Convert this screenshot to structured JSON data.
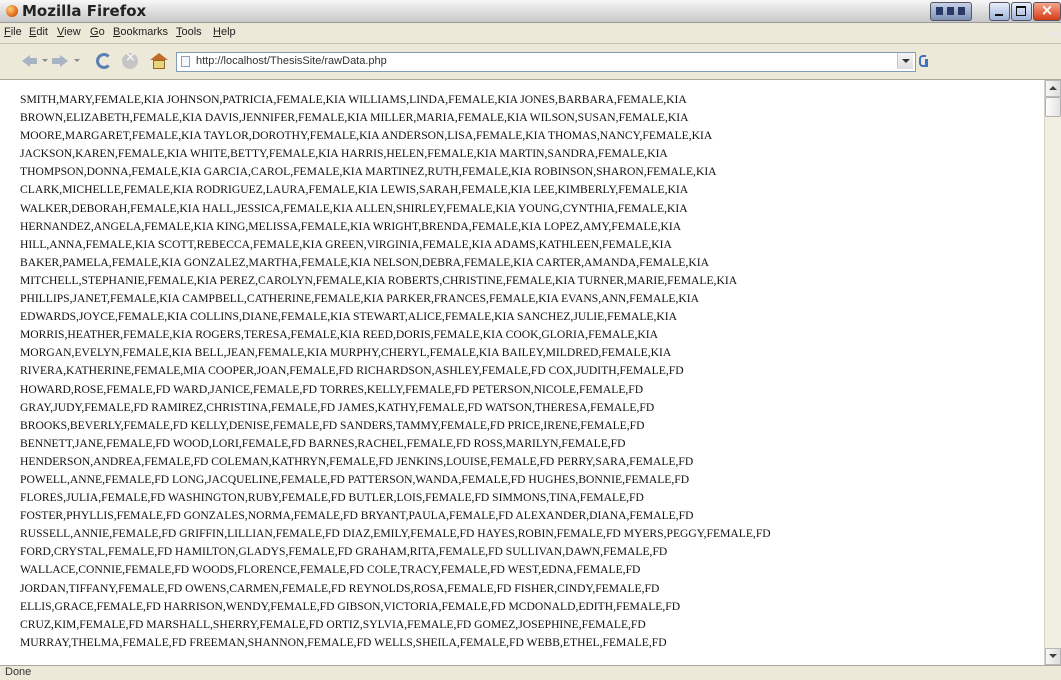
{
  "window": {
    "title": "Mozilla Firefox"
  },
  "menu": {
    "file": "File",
    "edit": "Edit",
    "view": "View",
    "go": "Go",
    "bookmarks": "Bookmarks",
    "tools": "Tools",
    "help": "Help"
  },
  "navigation": {
    "url": "http://localhost/ThesisSite/rawData.php"
  },
  "page": {
    "lines": [
      "SMITH,MARY,FEMALE,KIA JOHNSON,PATRICIA,FEMALE,KIA WILLIAMS,LINDA,FEMALE,KIA JONES,BARBARA,FEMALE,KIA",
      "BROWN,ELIZABETH,FEMALE,KIA DAVIS,JENNIFER,FEMALE,KIA MILLER,MARIA,FEMALE,KIA WILSON,SUSAN,FEMALE,KIA",
      "MOORE,MARGARET,FEMALE,KIA TAYLOR,DOROTHY,FEMALE,KIA ANDERSON,LISA,FEMALE,KIA THOMAS,NANCY,FEMALE,KIA",
      "JACKSON,KAREN,FEMALE,KIA WHITE,BETTY,FEMALE,KIA HARRIS,HELEN,FEMALE,KIA MARTIN,SANDRA,FEMALE,KIA",
      "THOMPSON,DONNA,FEMALE,KIA GARCIA,CAROL,FEMALE,KIA MARTINEZ,RUTH,FEMALE,KIA ROBINSON,SHARON,FEMALE,KIA",
      "CLARK,MICHELLE,FEMALE,KIA RODRIGUEZ,LAURA,FEMALE,KIA LEWIS,SARAH,FEMALE,KIA LEE,KIMBERLY,FEMALE,KIA",
      "WALKER,DEBORAH,FEMALE,KIA HALL,JESSICA,FEMALE,KIA ALLEN,SHIRLEY,FEMALE,KIA YOUNG,CYNTHIA,FEMALE,KIA",
      "HERNANDEZ,ANGELA,FEMALE,KIA KING,MELISSA,FEMALE,KIA WRIGHT,BRENDA,FEMALE,KIA LOPEZ,AMY,FEMALE,KIA",
      "HILL,ANNA,FEMALE,KIA SCOTT,REBECCA,FEMALE,KIA GREEN,VIRGINIA,FEMALE,KIA ADAMS,KATHLEEN,FEMALE,KIA",
      "BAKER,PAMELA,FEMALE,KIA GONZALEZ,MARTHA,FEMALE,KIA NELSON,DEBRA,FEMALE,KIA CARTER,AMANDA,FEMALE,KIA",
      "MITCHELL,STEPHANIE,FEMALE,KIA PEREZ,CAROLYN,FEMALE,KIA ROBERTS,CHRISTINE,FEMALE,KIA TURNER,MARIE,FEMALE,KIA",
      "PHILLIPS,JANET,FEMALE,KIA CAMPBELL,CATHERINE,FEMALE,KIA PARKER,FRANCES,FEMALE,KIA EVANS,ANN,FEMALE,KIA",
      "EDWARDS,JOYCE,FEMALE,KIA COLLINS,DIANE,FEMALE,KIA STEWART,ALICE,FEMALE,KIA SANCHEZ,JULIE,FEMALE,KIA",
      "MORRIS,HEATHER,FEMALE,KIA ROGERS,TERESA,FEMALE,KIA REED,DORIS,FEMALE,KIA COOK,GLORIA,FEMALE,KIA",
      "MORGAN,EVELYN,FEMALE,KIA BELL,JEAN,FEMALE,KIA MURPHY,CHERYL,FEMALE,KIA BAILEY,MILDRED,FEMALE,KIA",
      "RIVERA,KATHERINE,FEMALE,MIA COOPER,JOAN,FEMALE,FD RICHARDSON,ASHLEY,FEMALE,FD COX,JUDITH,FEMALE,FD",
      "HOWARD,ROSE,FEMALE,FD WARD,JANICE,FEMALE,FD TORRES,KELLY,FEMALE,FD PETERSON,NICOLE,FEMALE,FD",
      "GRAY,JUDY,FEMALE,FD RAMIREZ,CHRISTINA,FEMALE,FD JAMES,KATHY,FEMALE,FD WATSON,THERESA,FEMALE,FD",
      "BROOKS,BEVERLY,FEMALE,FD KELLY,DENISE,FEMALE,FD SANDERS,TAMMY,FEMALE,FD PRICE,IRENE,FEMALE,FD",
      "BENNETT,JANE,FEMALE,FD WOOD,LORI,FEMALE,FD BARNES,RACHEL,FEMALE,FD ROSS,MARILYN,FEMALE,FD",
      "HENDERSON,ANDREA,FEMALE,FD COLEMAN,KATHRYN,FEMALE,FD JENKINS,LOUISE,FEMALE,FD PERRY,SARA,FEMALE,FD",
      "POWELL,ANNE,FEMALE,FD LONG,JACQUELINE,FEMALE,FD PATTERSON,WANDA,FEMALE,FD HUGHES,BONNIE,FEMALE,FD",
      "FLORES,JULIA,FEMALE,FD WASHINGTON,RUBY,FEMALE,FD BUTLER,LOIS,FEMALE,FD SIMMONS,TINA,FEMALE,FD",
      "FOSTER,PHYLLIS,FEMALE,FD GONZALES,NORMA,FEMALE,FD BRYANT,PAULA,FEMALE,FD ALEXANDER,DIANA,FEMALE,FD",
      "RUSSELL,ANNIE,FEMALE,FD GRIFFIN,LILLIAN,FEMALE,FD DIAZ,EMILY,FEMALE,FD HAYES,ROBIN,FEMALE,FD MYERS,PEGGY,FEMALE,FD",
      "FORD,CRYSTAL,FEMALE,FD HAMILTON,GLADYS,FEMALE,FD GRAHAM,RITA,FEMALE,FD SULLIVAN,DAWN,FEMALE,FD",
      "WALLACE,CONNIE,FEMALE,FD WOODS,FLORENCE,FEMALE,FD COLE,TRACY,FEMALE,FD WEST,EDNA,FEMALE,FD",
      "JORDAN,TIFFANY,FEMALE,FD OWENS,CARMEN,FEMALE,FD REYNOLDS,ROSA,FEMALE,FD FISHER,CINDY,FEMALE,FD",
      "ELLIS,GRACE,FEMALE,FD HARRISON,WENDY,FEMALE,FD GIBSON,VICTORIA,FEMALE,FD MCDONALD,EDITH,FEMALE,FD",
      "CRUZ,KIM,FEMALE,FD MARSHALL,SHERRY,FEMALE,FD ORTIZ,SYLVIA,FEMALE,FD GOMEZ,JOSEPHINE,FEMALE,FD",
      "MURRAY,THELMA,FEMALE,FD FREEMAN,SHANNON,FEMALE,FD WELLS,SHEILA,FEMALE,FD WEBB,ETHEL,FEMALE,FD"
    ]
  },
  "status": {
    "text": "Done"
  }
}
